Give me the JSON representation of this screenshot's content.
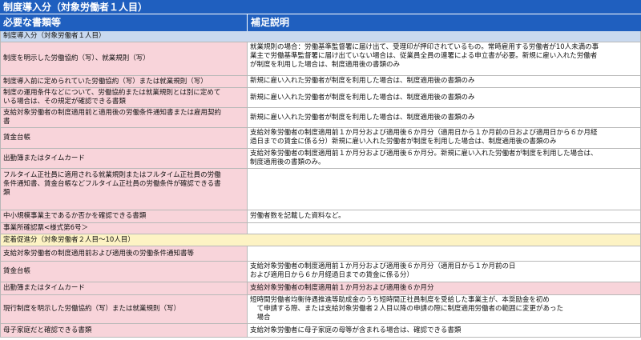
{
  "title": "制度導入分（対象労働者１人目）",
  "headers": {
    "required_docs": "必要な書類等",
    "notes": "補足説明"
  },
  "section1": "制度導入分（対象労働者１人目）",
  "rows": [
    {
      "doc": "制度を明示した労働協約（写）、就業規則（写）",
      "note": "就業規則の場合：労働基準監督署に届け出て、受理印が押印されているもの。常時雇用する労働者が10人未満の事\n業主で労働基準監督署に届け出ていない場合は、従業員全員の連署による申立書が必要。新規に雇い入れた労働者\nが制度を利用した場合は、制度適用後の書類のみ"
    },
    {
      "doc": "制度導入前に定められていた労働協約（写）または就業規則（写）",
      "note": "新規に雇い入れた労働者が制度を利用した場合は、制度適用後の書類のみ"
    },
    {
      "doc": "制度の運用条件などについて、労働協約または就業規則とは別に定めて\nいる場合は、その規定が確認できる書類",
      "note": "新規に雇い入れた労働者が制度を利用した場合は、制度適用後の書類のみ"
    },
    {
      "doc": "支給対象労働者の制度適用前と適用後の労働条件通知書または雇用契約\n書",
      "note": "新規に雇い入れた労働者が制度を利用した場合は、制度適用後の書類のみ"
    },
    {
      "doc": "賃金台帳",
      "note": "支給対象労働者の制度適用前１か月分および適用後６か月分（適用日から１か月前の日および適用日から６か月経\n過日までの賃金に係る分）新規に雇い入れた労働者が制度を利用した場合は、制度適用後の書類のみ"
    },
    {
      "doc": "出勤簿またはタイムカード",
      "note": "支給対象労働者の制度適用前１か月分および適用後６か月分。新規に雇い入れた労働者が制度を利用した場合は、\n制度適用後の書類のみ。"
    },
    {
      "doc": "フルタイム正社員に適用される就業規則またはフルタイム正社員の労働\n条件通知書、賃金台帳などフルタイム正社員の労働条件が確認できる書\n類",
      "note": ""
    },
    {
      "doc": "中小規模事業主であるか否かを確認できる書類",
      "note": "労働者数を記載した資料など。"
    },
    {
      "doc": "事業所確認票<様式第6号＞",
      "note": ""
    }
  ],
  "section2": "定着促進分（対象労働者２人目〜10人目）",
  "rows2": [
    {
      "doc": "支給対象労働者の制度適用前および適用後の労働条件通知書等",
      "note": ""
    },
    {
      "doc": "賃金台帳",
      "note": "支給対象労働者の制度適用前１か月分および適用後６か月分（適用日から１か月前の日\nおよび適用日から６か月経過日までの賃金に係る分）"
    },
    {
      "doc": "出勤簿またはタイムカード",
      "note": "支給対象労働者の制度適用前１か月分および適用後６か月分"
    },
    {
      "doc": "現行制度を明示した労働協約（写）または就業規則（写）",
      "note": "短時間労働者均衡待遇推進等助成金のうち短時間正社員制度を受給した事業主が、本奨励金を初め\n　て申請する際、または支給対象労働者２人目以降の申請の際に制度適用労働者の範囲に変更があった\n　場合"
    },
    {
      "doc": "母子家庭だと確認できる書類",
      "note": "支給対象労働者に母子家庭の母等が含まれる場合は、確認できる書類"
    }
  ]
}
